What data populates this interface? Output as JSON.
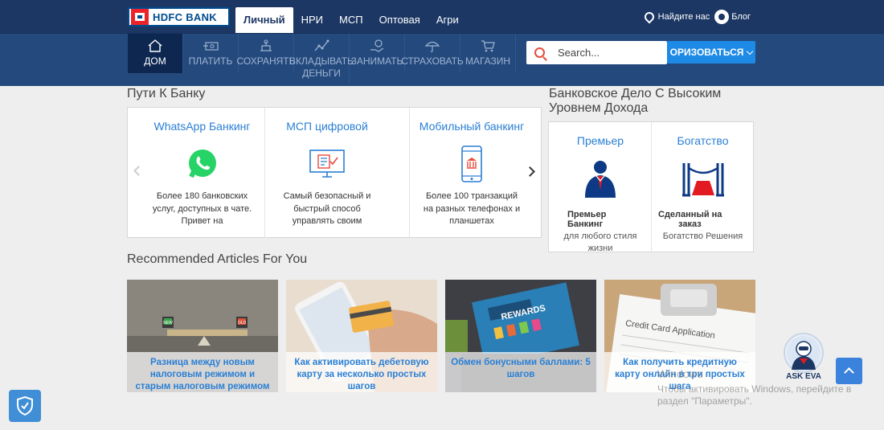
{
  "brand": {
    "name": "HDFC BANK"
  },
  "top_tabs": [
    {
      "label": "Личный"
    },
    {
      "label": "НРИ"
    },
    {
      "label": "МСП"
    },
    {
      "label": "Оптовая"
    },
    {
      "label": "Агри"
    }
  ],
  "top_links": {
    "locate": "Найдите нас",
    "blog": "Блог"
  },
  "nav": {
    "home": "ДОМ",
    "pay": "ПЛАТИТЬ",
    "save": "СОХРАНЯТЬ",
    "invest_line1": "ВКЛАДЫВАТЬ",
    "invest_line2": "ДЕНЬГИ",
    "borrow": "ЗАНИМАТЬ",
    "insure": "СТРАХОВАТЬ",
    "shop": "МАГАЗИН"
  },
  "search": {
    "placeholder": "Search..."
  },
  "login": {
    "label": "ОРИЗОВАТЬСЯ"
  },
  "ways_section": {
    "title": "Пути К Банку",
    "cards": [
      {
        "title": "WhatsApp Банкинг",
        "desc": "Более 180 банковских услуг, доступных в чате. Привет на",
        "icon": "whatsapp-icon"
      },
      {
        "title": "МСП цифровой",
        "desc": "Самый безопасный и быстрый способ управлять своим",
        "icon": "monitor-check-icon"
      },
      {
        "title": "Мобильный банкинг",
        "desc": "Более 100 транзакций на разных телефонах и планшетах",
        "icon": "mobile-bank-icon"
      }
    ]
  },
  "premier_section": {
    "title_line1": "Банковское Дело С Высоким",
    "title_line2": "Уровнем Дохода",
    "cards": [
      {
        "title": "Премьер",
        "bold_line1": "Премьер",
        "bold_line2": "Банкинг",
        "sub_line1": "для любого стиля",
        "sub_line2": "жизни",
        "icon": "businessman-icon"
      },
      {
        "title": "Богатство",
        "bold_line1": "Сделанный на",
        "bold_line2": "заказ",
        "sub_line1": "Богатство Решения",
        "sub_line2": "",
        "icon": "stanchion-carpet-icon"
      }
    ]
  },
  "articles_section": {
    "title": "Recommended Articles For You",
    "items": [
      {
        "caption": "Разница между новым налоговым режимом и старым налоговым режимом",
        "tag_new": "NEW",
        "tag_old": "OLD"
      },
      {
        "caption": "Как активировать дебетовую карту за несколько простых шагов"
      },
      {
        "caption": "Обмен бонусными баллами: 5 шагов",
        "sign": "REWARDS"
      },
      {
        "caption": "Как получить кредитную карту онлайн в три простых шага",
        "form_title": "Credit Card Application"
      }
    ]
  },
  "watermark": {
    "line1": "Windows",
    "line2": "Чтобы активировать Windows, перейдите в раздел \"Параметры\"."
  },
  "assistant": {
    "label": "ASK EVA"
  },
  "colors": {
    "header_dark": "#1c3764",
    "nav_blue": "#244a7d",
    "accent_blue": "#2a7fd4",
    "brand_red": "#ed232a"
  }
}
